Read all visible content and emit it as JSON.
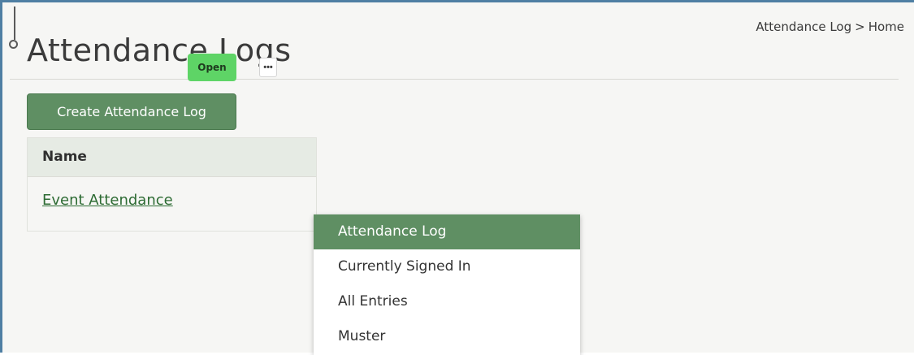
{
  "breadcrumb": {
    "items": [
      "Attendance Log",
      "Home"
    ],
    "separator": ">"
  },
  "page": {
    "title": "Attendance Logs"
  },
  "toolbar": {
    "create_label": "Create Attendance Log"
  },
  "table": {
    "columns": [
      "Name"
    ],
    "rows": [
      {
        "name": "Event Attendance",
        "status": "Open",
        "more_label": "•••"
      }
    ]
  },
  "dropdown": {
    "items": [
      {
        "label": "Attendance Log",
        "active": true
      },
      {
        "label": "Currently Signed In",
        "active": false
      },
      {
        "label": "All Entries",
        "active": false
      },
      {
        "label": "Muster",
        "active": false
      }
    ]
  },
  "colors": {
    "accent": "#5f8f63",
    "status_open": "#5ed466",
    "link": "#2d6b33",
    "frame": "#4f7fa3"
  }
}
